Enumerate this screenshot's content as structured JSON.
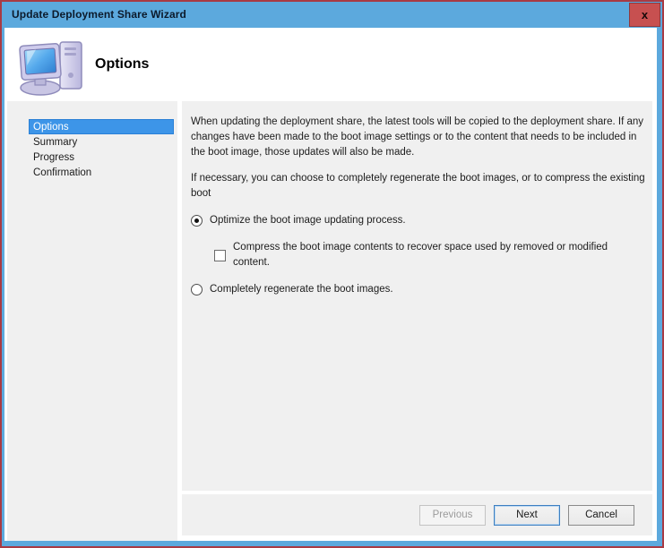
{
  "window": {
    "title": "Update Deployment Share Wizard",
    "close_glyph": "x",
    "colors": {
      "frame_blue": "#5ca9dd",
      "outer_red": "#a83b44",
      "close_red": "#c75050",
      "panel_gray": "#f0f0f0",
      "selected_blue": "#3d95e8"
    }
  },
  "header": {
    "title": "Options",
    "icon": "computer-icon"
  },
  "sidebar": {
    "items": [
      {
        "label": "Options",
        "selected": true
      },
      {
        "label": "Summary",
        "selected": false
      },
      {
        "label": "Progress",
        "selected": false
      },
      {
        "label": "Confirmation",
        "selected": false
      }
    ]
  },
  "content": {
    "paragraph1": "When updating the deployment share, the latest tools will be copied to the deployment share.  If any changes have been made to the boot image settings or to the content that needs to be included in the boot image, those updates will also be made.",
    "paragraph2": "If necessary, you can choose to completely regenerate the boot images, or to compress the existing boot",
    "options": {
      "radio_optimize": {
        "label": "Optimize the boot image updating process.",
        "selected": true
      },
      "checkbox_compress": {
        "label": "Compress the boot image contents to recover space used by removed or modified content.",
        "checked": false
      },
      "radio_regenerate": {
        "label": "Completely regenerate the boot images.",
        "selected": false
      }
    }
  },
  "footer": {
    "previous_label": "Previous",
    "next_label": "Next",
    "cancel_label": "Cancel"
  }
}
